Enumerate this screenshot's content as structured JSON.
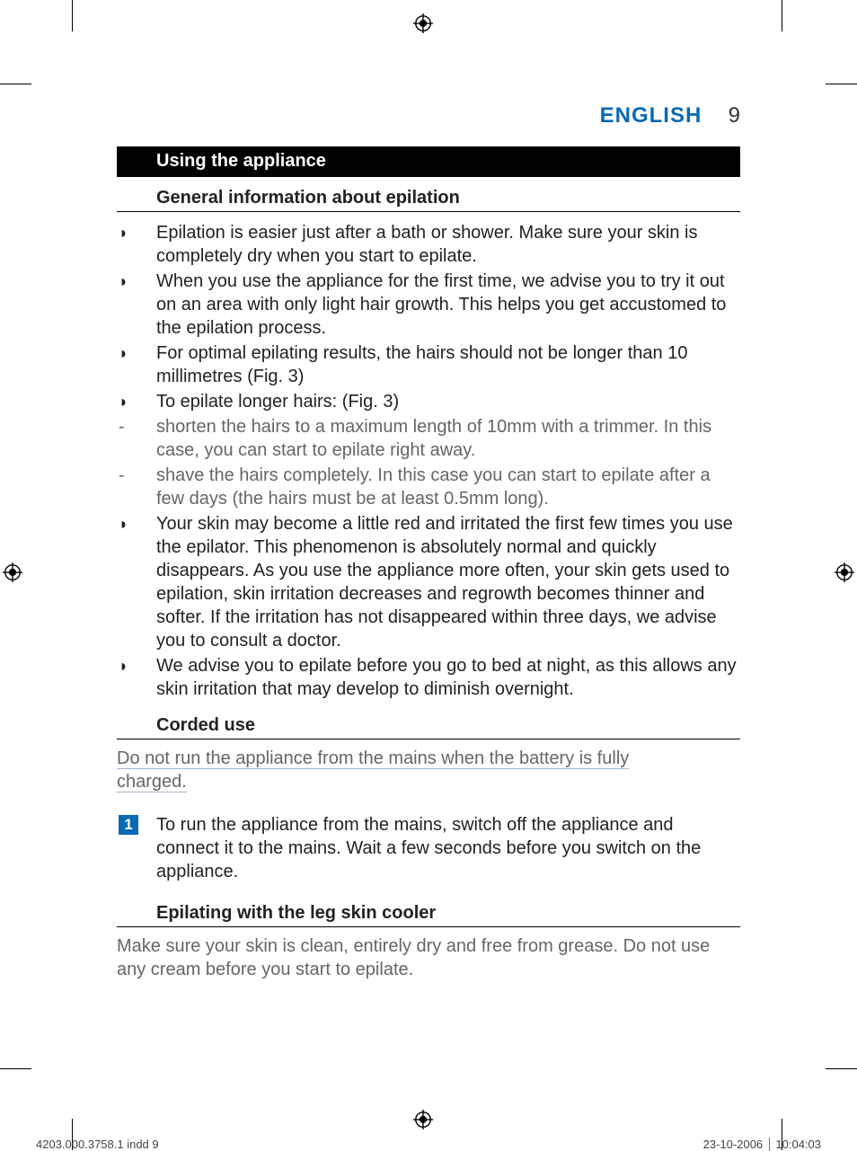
{
  "header": {
    "language": "ENGLISH",
    "page_number": "9"
  },
  "sections": {
    "using_title": "Using the appliance",
    "general_info_title": "General information about epilation",
    "bullets": {
      "b1": "Epilation is easier just after a bath or shower. Make sure your skin is completely dry when you start to epilate.",
      "b2": "When you use the appliance for the first time, we advise you to try it out on an area with only light hair growth. This helps you get accustomed to the epilation process.",
      "b3": "For optimal epilating results, the hairs should not be longer than 10 millimetres (Fig. 3)",
      "b4": "To epilate longer hairs: (Fig. 3)",
      "d1": "shorten the hairs to a maximum length of 10mm with a trimmer. In this case, you can start to epilate right away.",
      "d2": "shave the hairs completely. In this case you can start to epilate after a few days (the hairs must be at least 0.5mm long).",
      "b5": "Your skin may become a little red and irritated the first few times you use the epilator. This phenomenon is absolutely normal and quickly disappears. As you use the appliance more often, your skin gets used to epilation, skin irritation decreases and regrowth becomes thinner and softer. If the irritation has not disappeared within three days, we advise you to consult a doctor.",
      "b6": "We advise you to epilate before you go to bed at night, as this allows any skin irritation that may develop to diminish overnight."
    },
    "corded_title": "Corded use",
    "corded_warning_l1": "Do not run the appliance from the mains when the battery is fully",
    "corded_warning_l2": "charged.",
    "step1_num": "1",
    "step1_text": "To run the appliance from the mains, switch off the appliance and connect it to the mains. Wait a few seconds before you switch on the appliance.",
    "legcooler_title": "Epilating with the leg skin cooler",
    "legcooler_para": "Make sure your skin is clean, entirely dry and free from grease. Do not use any cream before you start to epilate."
  },
  "footer": {
    "left": "4203.000.3758.1 indd   9",
    "date": "23-10-2006",
    "time": "10:04:03"
  }
}
